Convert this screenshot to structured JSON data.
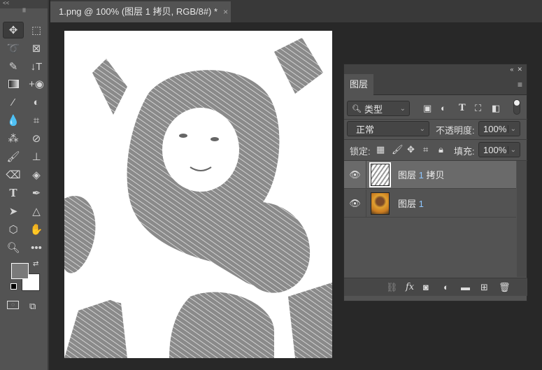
{
  "toolbar": {
    "collapse": "<<",
    "tools": [
      "move",
      "rect-marquee",
      "lasso",
      "frame",
      "quick-select",
      "text-vertical-mask",
      "gradient",
      "red-eye",
      "eyedropper",
      "blur-tool",
      "drop",
      "crop",
      "magic-wand",
      "color-sampler",
      "brush",
      "stamp",
      "eraser",
      "paint-bucket",
      "type",
      "pen",
      "path-select",
      "triangle",
      "polygon",
      "hand",
      "zoom",
      "more"
    ],
    "fg_color": "#7a7a7a",
    "bg_color": "#ffffff"
  },
  "document": {
    "tab_title": "1.png @ 100% (图层 1 拷贝, RGB/8#) *",
    "close": "×"
  },
  "layers_panel": {
    "title": "图层",
    "filter": "类型",
    "blend_mode": "正常",
    "opacity_label": "不透明度:",
    "opacity": "100%",
    "lock_label": "锁定:",
    "fill_label": "填充:",
    "fill": "100%",
    "layers": [
      {
        "name": "图层",
        "num": "1",
        "suffix": " 拷贝",
        "selected": true
      },
      {
        "name": "图层",
        "num": "1",
        "suffix": "",
        "selected": false
      }
    ]
  }
}
